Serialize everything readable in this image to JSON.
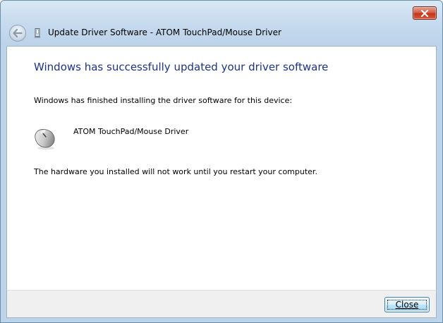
{
  "window": {
    "title": "Update Driver Software - ATOM TouchPad/Mouse Driver",
    "close_icon": "close-icon",
    "back_icon": "back-arrow-icon",
    "app_icon": "device-manager-icon"
  },
  "content": {
    "heading": "Windows has successfully updated your driver software",
    "info": "Windows has finished installing the driver software for this device:",
    "device_icon": "mouse-icon",
    "device_name": "ATOM TouchPad/Mouse Driver",
    "restart_notice": "The hardware you installed will not work until you restart your computer."
  },
  "footer": {
    "close_label": "Close"
  },
  "colors": {
    "heading": "#1e3287",
    "chrome": "#bcd3ea",
    "close_x": "#c2341b",
    "button_border": "#3c7fb1"
  }
}
